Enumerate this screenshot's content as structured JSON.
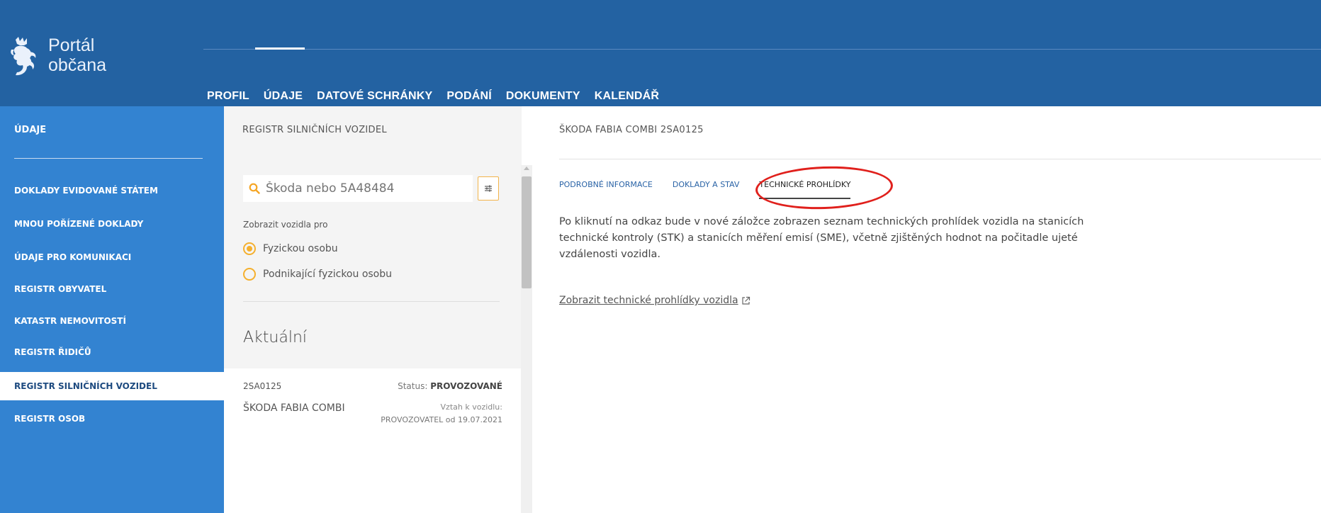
{
  "header": {
    "logo_line1": "Portál",
    "logo_line2": "občana",
    "nav": [
      "PROFIL",
      "ÚDAJE",
      "DATOVÉ SCHRÁNKY",
      "PODÁNÍ",
      "DOKUMENTY",
      "KALENDÁŘ"
    ],
    "active_nav": "ÚDAJE"
  },
  "sidebar": {
    "title": "ÚDAJE",
    "items": [
      "DOKLADY EVIDOVANÉ STÁTEM",
      "MNOU POŘÍZENÉ DOKLADY",
      "ÚDAJE PRO KOMUNIKACI",
      "REGISTR OBYVATEL",
      "KATASTR NEMOVITOSTÍ",
      "REGISTR ŘIDIČŮ",
      "REGISTR SILNIČNÍCH VOZIDEL",
      "REGISTR OSOB"
    ],
    "active_item": "REGISTR SILNIČNÍCH VOZIDEL"
  },
  "middle": {
    "title": "REGISTR SILNIČNÍCH VOZIDEL",
    "search_placeholder": "Škoda nebo 5A48484",
    "show_label": "Zobrazit vozidla pro",
    "radio_options": [
      "Fyzickou osobu",
      "Podnikající fyzickou osobu"
    ],
    "selected_radio": "Fyzickou osobu",
    "section": "Aktuální",
    "vehicle": {
      "plate": "2SA0125",
      "status_label": "Status:",
      "status": "PROVOZOVANÉ",
      "name": "ŠKODA FABIA COMBI",
      "relation_label": "Vztah k vozidlu:",
      "relation": "PROVOZOVATEL od 19.07.2021"
    }
  },
  "detail": {
    "title": "ŠKODA FABIA COMBI 2SA0125",
    "tabs": [
      "PODROBNÉ INFORMACE",
      "DOKLADY A STAV",
      "TECHNICKÉ PROHLÍDKY"
    ],
    "active_tab": "TECHNICKÉ PROHLÍDKY",
    "description": "Po kliknutí na odkaz bude v nové záložce zobrazen seznam technických prohlídek vozidla na stanicích technické kontroly (STK) a stanicích měření emisí (SME), včetně zjištěných hodnot na počitadle ujeté vzdálenosti vozidla.",
    "link": "Zobrazit technické prohlídky vozidla"
  },
  "colors": {
    "header_bg": "#2362a2",
    "sidebar_bg": "#3383d1",
    "accent": "#f5b02e",
    "highlight": "#e0201c"
  }
}
